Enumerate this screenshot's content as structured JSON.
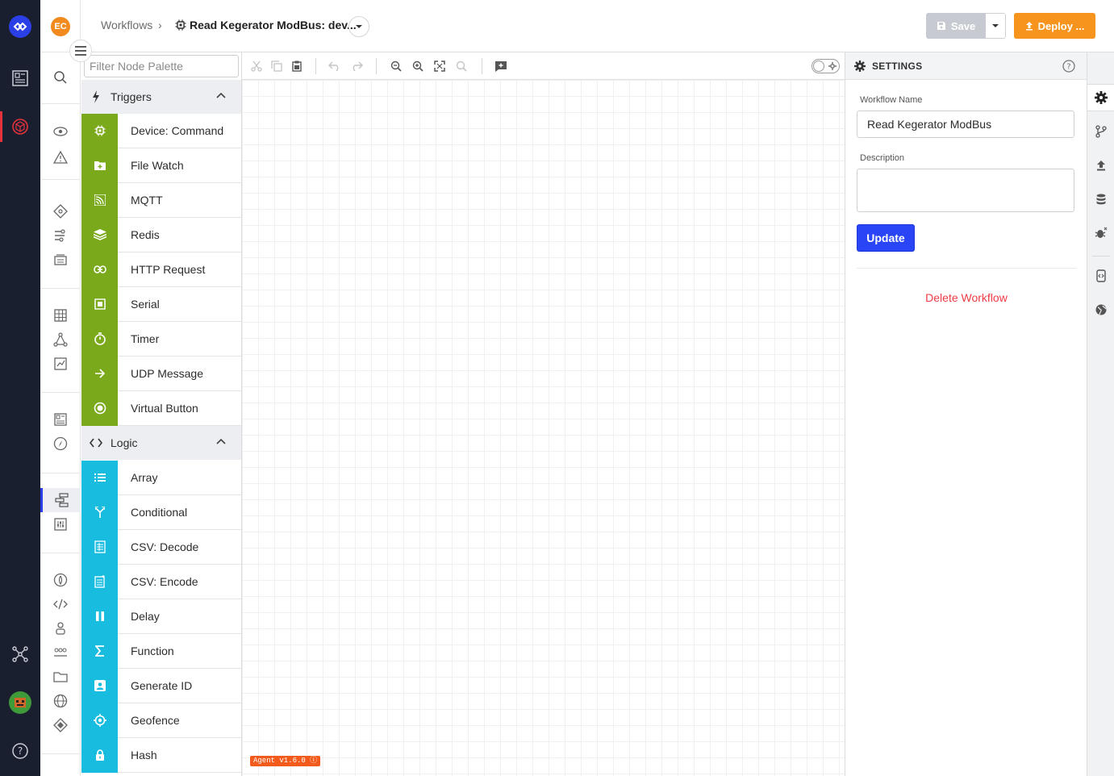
{
  "header": {
    "breadcrumb_root": "Workflows",
    "breadcrumb_sep": "›",
    "workflow_title": "Read Kegerator ModBus: dev...",
    "save_label": "Save",
    "deploy_label": "Deploy ..."
  },
  "user": {
    "initials": "EC"
  },
  "palette": {
    "filter_placeholder": "Filter Node Palette",
    "triggers": {
      "label": "Triggers",
      "items": [
        {
          "label": "Device: Command",
          "icon": "chip-icon"
        },
        {
          "label": "File Watch",
          "icon": "folder-plus-icon"
        },
        {
          "label": "MQTT",
          "icon": "mqtt-icon"
        },
        {
          "label": "Redis",
          "icon": "layers-icon"
        },
        {
          "label": "HTTP Request",
          "icon": "link-icon"
        },
        {
          "label": "Serial",
          "icon": "serial-icon"
        },
        {
          "label": "Timer",
          "icon": "stopwatch-icon"
        },
        {
          "label": "UDP Message",
          "icon": "arrow-right-icon"
        },
        {
          "label": "Virtual Button",
          "icon": "radio-button-icon"
        }
      ]
    },
    "logic": {
      "label": "Logic",
      "items": [
        {
          "label": "Array",
          "icon": "list-icon"
        },
        {
          "label": "Conditional",
          "icon": "fork-icon"
        },
        {
          "label": "CSV: Decode",
          "icon": "csv-decode-icon"
        },
        {
          "label": "CSV: Encode",
          "icon": "csv-encode-icon"
        },
        {
          "label": "Delay",
          "icon": "pause-icon"
        },
        {
          "label": "Function",
          "icon": "sigma-icon"
        },
        {
          "label": "Generate ID",
          "icon": "id-card-icon"
        },
        {
          "label": "Geofence",
          "icon": "crosshair-icon"
        },
        {
          "label": "Hash",
          "icon": "lock-icon"
        }
      ]
    }
  },
  "canvas": {
    "agent_version": "Agent v1.6.0"
  },
  "settings": {
    "title": "SETTINGS",
    "workflow_name_label": "Workflow Name",
    "workflow_name_value": "Read Kegerator ModBus",
    "description_label": "Description",
    "description_value": "",
    "update_label": "Update",
    "delete_label": "Delete Workflow"
  },
  "colors": {
    "triggers": "#7aaa1c",
    "logic": "#18bcdf",
    "deploy": "#f7941d",
    "update": "#2a45f5",
    "delete": "#ef3b44"
  }
}
